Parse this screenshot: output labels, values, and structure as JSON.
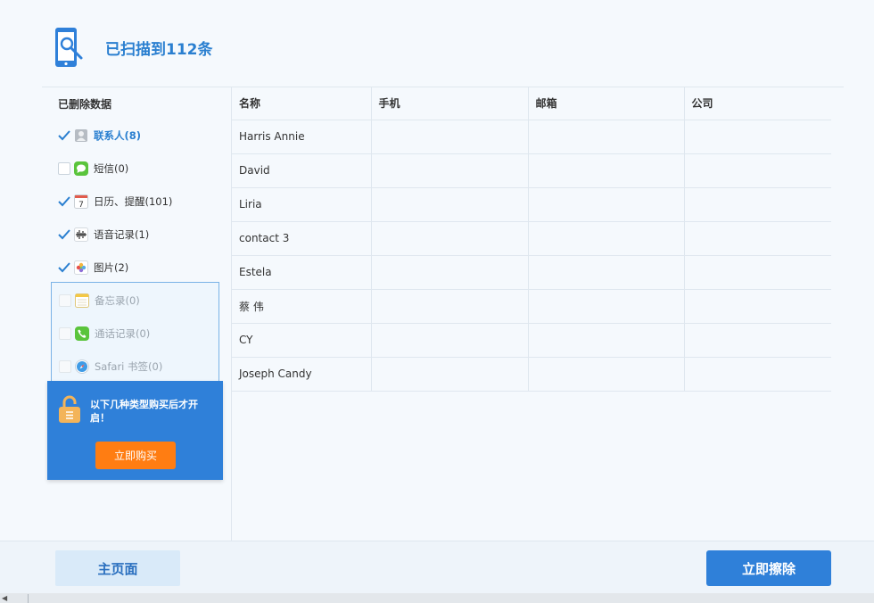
{
  "header": {
    "title": "已扫描到112条"
  },
  "sidebar": {
    "title": "已删除数据",
    "items": [
      {
        "label": "联系人(8)",
        "checked": true,
        "active": true,
        "icon": "contacts-icon"
      },
      {
        "label": "短信(0)",
        "checked": false,
        "active": false,
        "icon": "message-icon"
      },
      {
        "label": "日历、提醒(101)",
        "checked": true,
        "active": false,
        "icon": "calendar-icon"
      },
      {
        "label": "语音记录(1)",
        "checked": true,
        "active": false,
        "icon": "voice-memo-icon"
      },
      {
        "label": "图片(2)",
        "checked": true,
        "active": false,
        "icon": "photos-icon"
      }
    ],
    "locked_items": [
      {
        "label": "备忘录(0)",
        "icon": "notes-icon"
      },
      {
        "label": "通话记录(0)",
        "icon": "phone-icon"
      },
      {
        "label": "Safari 书签(0)",
        "icon": "safari-icon"
      }
    ]
  },
  "promo": {
    "text": "以下几种类型购买后才开启！",
    "buy_label": "立即购买"
  },
  "table": {
    "columns": [
      "名称",
      "手机",
      "邮箱",
      "公司"
    ],
    "rows": [
      [
        "Harris Annie",
        "",
        "",
        ""
      ],
      [
        "David",
        "",
        "",
        ""
      ],
      [
        "Liria",
        "",
        "",
        ""
      ],
      [
        "contact 3",
        "",
        "",
        ""
      ],
      [
        "Estela",
        "",
        "",
        ""
      ],
      [
        "蔡 伟",
        "",
        "",
        ""
      ],
      [
        "CY",
        "",
        "",
        ""
      ],
      [
        "Joseph Candy",
        "",
        "",
        ""
      ]
    ]
  },
  "footer": {
    "home_label": "主页面",
    "erase_label": "立即擦除"
  },
  "colors": {
    "accent": "#2f80d9",
    "title": "#2a7fd0",
    "buy": "#ff7d12",
    "home_bg": "#d9eaf9"
  }
}
